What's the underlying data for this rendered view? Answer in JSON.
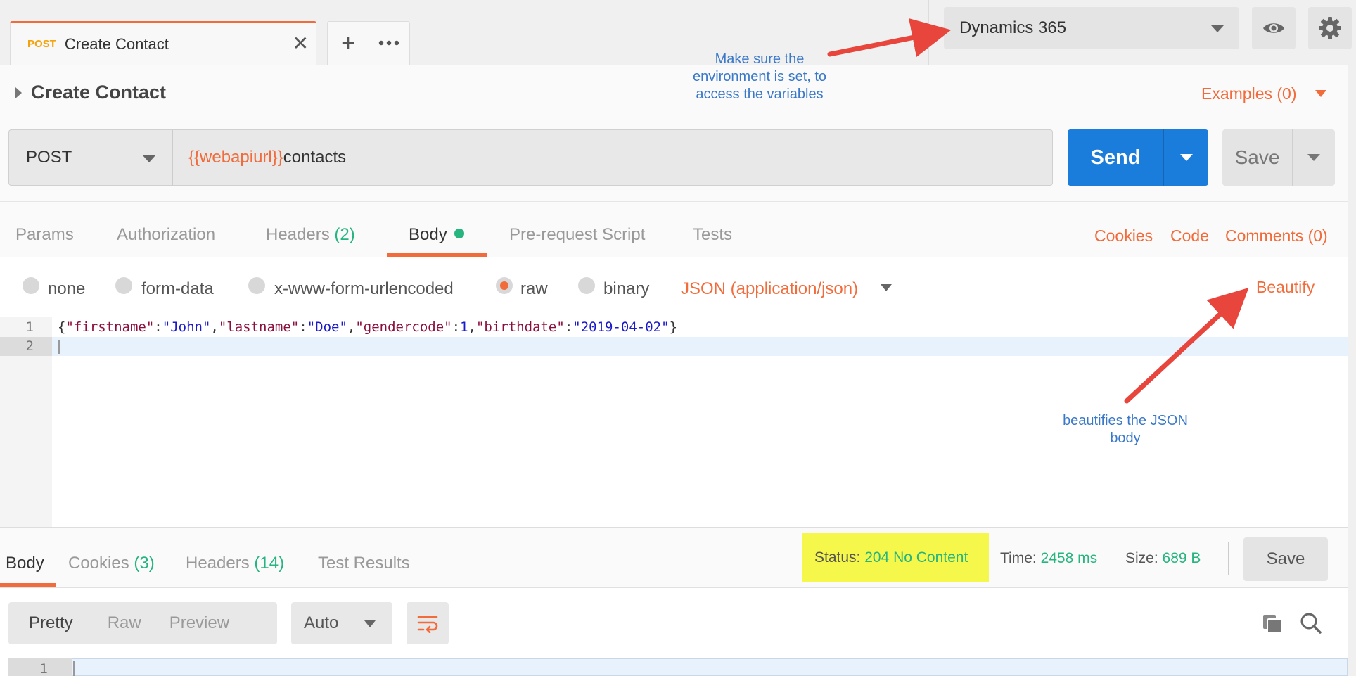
{
  "tab": {
    "method": "POST",
    "title": "Create Contact"
  },
  "environment": {
    "selected": "Dynamics 365"
  },
  "request": {
    "title": "Create Contact",
    "examples_label": "Examples (0)",
    "method": "POST",
    "url_variable": "{{webapiurl}}",
    "url_path": "contacts",
    "send_label": "Send",
    "save_label": "Save"
  },
  "request_tabs": {
    "params": "Params",
    "authorization": "Authorization",
    "headers": "Headers",
    "headers_count": "(2)",
    "body": "Body",
    "prerequest": "Pre-request Script",
    "tests": "Tests",
    "cookies": "Cookies",
    "code": "Code",
    "comments": "Comments (0)"
  },
  "body_modes": {
    "none": "none",
    "form_data": "form-data",
    "urlencoded": "x-www-form-urlencoded",
    "raw": "raw",
    "binary": "binary",
    "selected": "raw",
    "content_type": "JSON (application/json)",
    "beautify": "Beautify"
  },
  "editor": {
    "line_numbers": [
      "1",
      "2"
    ],
    "code": {
      "open": "{",
      "k1": "\"firstname\"",
      "v1": "\"John\"",
      "k2": "\"lastname\"",
      "v2": "\"Doe\"",
      "k3": "\"gendercode\"",
      "v3": "1",
      "k4": "\"birthdate\"",
      "v4": "\"2019-04-02\"",
      "close": "}"
    }
  },
  "response": {
    "tabs": {
      "body": "Body",
      "cookies": "Cookies",
      "cookies_count": "(3)",
      "headers": "Headers",
      "headers_count": "(14)",
      "test_results": "Test Results"
    },
    "status_label": "Status:",
    "status_value": "204 No Content",
    "time_label": "Time:",
    "time_value": "2458 ms",
    "size_label": "Size:",
    "size_value": "689 B",
    "save_label": "Save",
    "view_modes": {
      "pretty": "Pretty",
      "raw": "Raw",
      "preview": "Preview"
    },
    "format": "Auto",
    "line_number": "1"
  },
  "annotations": {
    "environment_note": "Make sure the environment is set, to access the variables",
    "beautify_note": "beautifies the JSON body",
    "arrow_color": "#e8453c"
  },
  "colors": {
    "accent": "#f26b3a",
    "send": "#1a7ddb",
    "success": "#26b47f",
    "highlight": "#f5f74a"
  }
}
